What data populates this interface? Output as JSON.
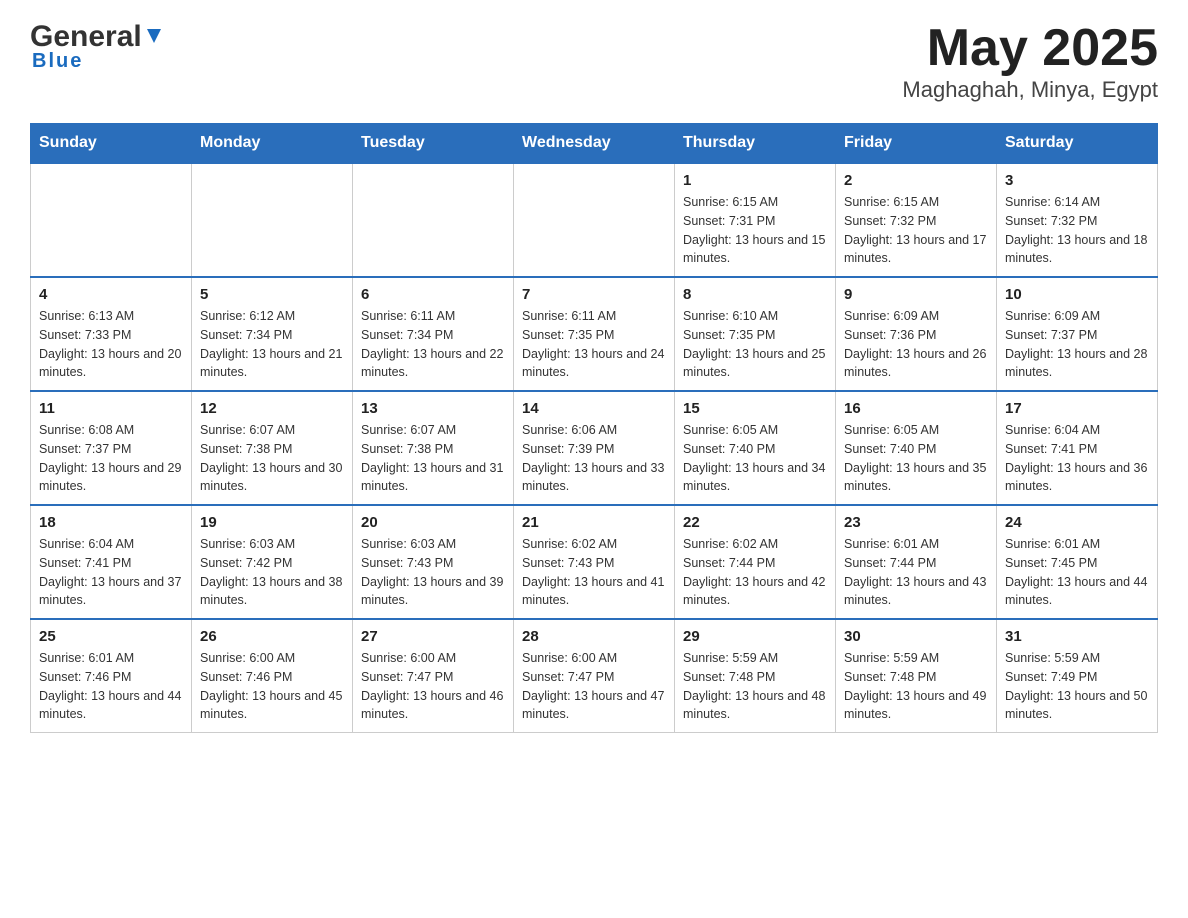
{
  "header": {
    "logo_general": "General",
    "logo_blue": "Blue",
    "title": "May 2025",
    "subtitle": "Maghaghah, Minya, Egypt"
  },
  "days_of_week": [
    "Sunday",
    "Monday",
    "Tuesday",
    "Wednesday",
    "Thursday",
    "Friday",
    "Saturday"
  ],
  "weeks": [
    {
      "days": [
        {
          "num": "",
          "info": ""
        },
        {
          "num": "",
          "info": ""
        },
        {
          "num": "",
          "info": ""
        },
        {
          "num": "",
          "info": ""
        },
        {
          "num": "1",
          "info": "Sunrise: 6:15 AM\nSunset: 7:31 PM\nDaylight: 13 hours and 15 minutes."
        },
        {
          "num": "2",
          "info": "Sunrise: 6:15 AM\nSunset: 7:32 PM\nDaylight: 13 hours and 17 minutes."
        },
        {
          "num": "3",
          "info": "Sunrise: 6:14 AM\nSunset: 7:32 PM\nDaylight: 13 hours and 18 minutes."
        }
      ]
    },
    {
      "days": [
        {
          "num": "4",
          "info": "Sunrise: 6:13 AM\nSunset: 7:33 PM\nDaylight: 13 hours and 20 minutes."
        },
        {
          "num": "5",
          "info": "Sunrise: 6:12 AM\nSunset: 7:34 PM\nDaylight: 13 hours and 21 minutes."
        },
        {
          "num": "6",
          "info": "Sunrise: 6:11 AM\nSunset: 7:34 PM\nDaylight: 13 hours and 22 minutes."
        },
        {
          "num": "7",
          "info": "Sunrise: 6:11 AM\nSunset: 7:35 PM\nDaylight: 13 hours and 24 minutes."
        },
        {
          "num": "8",
          "info": "Sunrise: 6:10 AM\nSunset: 7:35 PM\nDaylight: 13 hours and 25 minutes."
        },
        {
          "num": "9",
          "info": "Sunrise: 6:09 AM\nSunset: 7:36 PM\nDaylight: 13 hours and 26 minutes."
        },
        {
          "num": "10",
          "info": "Sunrise: 6:09 AM\nSunset: 7:37 PM\nDaylight: 13 hours and 28 minutes."
        }
      ]
    },
    {
      "days": [
        {
          "num": "11",
          "info": "Sunrise: 6:08 AM\nSunset: 7:37 PM\nDaylight: 13 hours and 29 minutes."
        },
        {
          "num": "12",
          "info": "Sunrise: 6:07 AM\nSunset: 7:38 PM\nDaylight: 13 hours and 30 minutes."
        },
        {
          "num": "13",
          "info": "Sunrise: 6:07 AM\nSunset: 7:38 PM\nDaylight: 13 hours and 31 minutes."
        },
        {
          "num": "14",
          "info": "Sunrise: 6:06 AM\nSunset: 7:39 PM\nDaylight: 13 hours and 33 minutes."
        },
        {
          "num": "15",
          "info": "Sunrise: 6:05 AM\nSunset: 7:40 PM\nDaylight: 13 hours and 34 minutes."
        },
        {
          "num": "16",
          "info": "Sunrise: 6:05 AM\nSunset: 7:40 PM\nDaylight: 13 hours and 35 minutes."
        },
        {
          "num": "17",
          "info": "Sunrise: 6:04 AM\nSunset: 7:41 PM\nDaylight: 13 hours and 36 minutes."
        }
      ]
    },
    {
      "days": [
        {
          "num": "18",
          "info": "Sunrise: 6:04 AM\nSunset: 7:41 PM\nDaylight: 13 hours and 37 minutes."
        },
        {
          "num": "19",
          "info": "Sunrise: 6:03 AM\nSunset: 7:42 PM\nDaylight: 13 hours and 38 minutes."
        },
        {
          "num": "20",
          "info": "Sunrise: 6:03 AM\nSunset: 7:43 PM\nDaylight: 13 hours and 39 minutes."
        },
        {
          "num": "21",
          "info": "Sunrise: 6:02 AM\nSunset: 7:43 PM\nDaylight: 13 hours and 41 minutes."
        },
        {
          "num": "22",
          "info": "Sunrise: 6:02 AM\nSunset: 7:44 PM\nDaylight: 13 hours and 42 minutes."
        },
        {
          "num": "23",
          "info": "Sunrise: 6:01 AM\nSunset: 7:44 PM\nDaylight: 13 hours and 43 minutes."
        },
        {
          "num": "24",
          "info": "Sunrise: 6:01 AM\nSunset: 7:45 PM\nDaylight: 13 hours and 44 minutes."
        }
      ]
    },
    {
      "days": [
        {
          "num": "25",
          "info": "Sunrise: 6:01 AM\nSunset: 7:46 PM\nDaylight: 13 hours and 44 minutes."
        },
        {
          "num": "26",
          "info": "Sunrise: 6:00 AM\nSunset: 7:46 PM\nDaylight: 13 hours and 45 minutes."
        },
        {
          "num": "27",
          "info": "Sunrise: 6:00 AM\nSunset: 7:47 PM\nDaylight: 13 hours and 46 minutes."
        },
        {
          "num": "28",
          "info": "Sunrise: 6:00 AM\nSunset: 7:47 PM\nDaylight: 13 hours and 47 minutes."
        },
        {
          "num": "29",
          "info": "Sunrise: 5:59 AM\nSunset: 7:48 PM\nDaylight: 13 hours and 48 minutes."
        },
        {
          "num": "30",
          "info": "Sunrise: 5:59 AM\nSunset: 7:48 PM\nDaylight: 13 hours and 49 minutes."
        },
        {
          "num": "31",
          "info": "Sunrise: 5:59 AM\nSunset: 7:49 PM\nDaylight: 13 hours and 50 minutes."
        }
      ]
    }
  ]
}
